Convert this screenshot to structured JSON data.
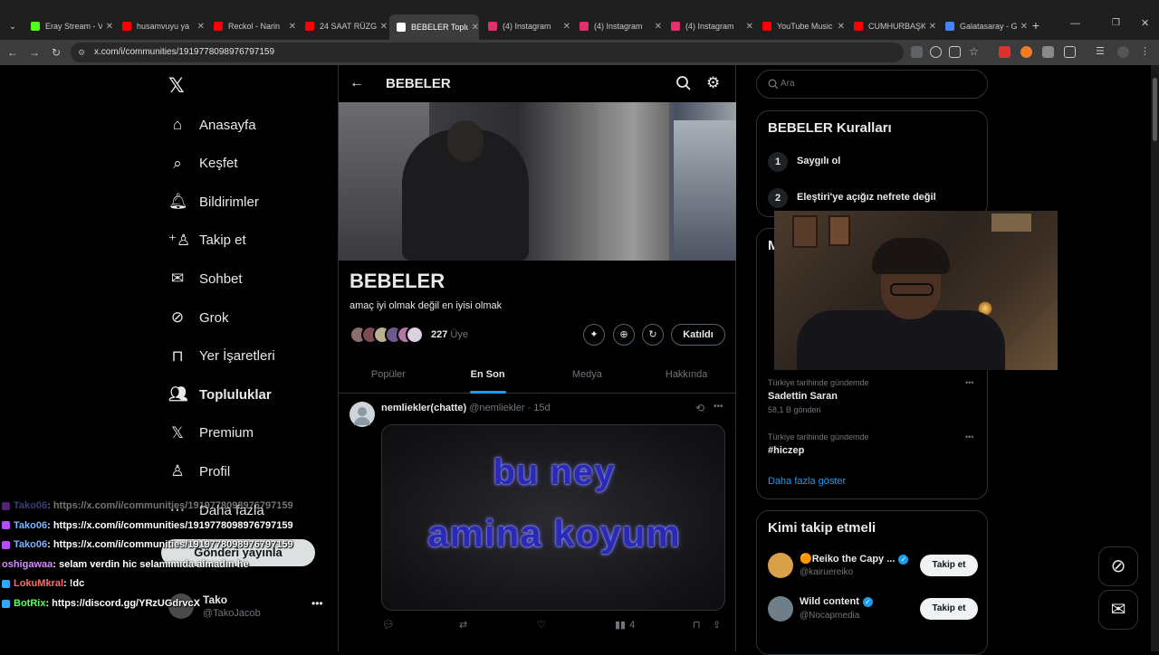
{
  "browser": {
    "tabs": [
      {
        "label": "Eray Stream - V",
        "color": "#53fc18"
      },
      {
        "label": "husamvuyu ya",
        "color": "#ff0000"
      },
      {
        "label": "Reckol - Narin",
        "color": "#ff0000"
      },
      {
        "label": "24 SAAT RÜZG",
        "color": "#ff0000"
      },
      {
        "label": "BEBELER Toplu",
        "color": "#ffffff"
      },
      {
        "label": "(4) Instagram",
        "color": "#e1306c"
      },
      {
        "label": "(4) Instagram",
        "color": "#e1306c"
      },
      {
        "label": "(4) Instagram",
        "color": "#e1306c"
      },
      {
        "label": "YouTube Music",
        "color": "#ff0000"
      },
      {
        "label": "CUMHURBAŞK",
        "color": "#ff0000"
      },
      {
        "label": "Galatasaray - G",
        "color": "#4285f4"
      }
    ],
    "url": "x.com/i/communities/1919778098976797159"
  },
  "nav": {
    "items": [
      {
        "label": "Anasayfa",
        "icon": "home-icon"
      },
      {
        "label": "Keşfet",
        "icon": "search-icon"
      },
      {
        "label": "Bildirimler",
        "icon": "bell-icon"
      },
      {
        "label": "Takip et",
        "icon": "add-user-icon"
      },
      {
        "label": "Sohbet",
        "icon": "mail-icon"
      },
      {
        "label": "Grok",
        "icon": "grok-icon"
      },
      {
        "label": "Yer İşaretleri",
        "icon": "bookmark-icon"
      },
      {
        "label": "Topluluklar",
        "icon": "communities-icon"
      },
      {
        "label": "Premium",
        "icon": "x-logo-icon"
      },
      {
        "label": "Profil",
        "icon": "profile-icon"
      },
      {
        "label": "Daha fazla",
        "icon": "more-icon"
      }
    ],
    "post_button": "Gönderi yayınla",
    "account_name": "Tako",
    "account_handle": "@TakoJacob"
  },
  "community": {
    "header_title": "BEBELER",
    "name": "BEBELER",
    "description": "amaç iyi olmak değil en iyisi olmak",
    "member_count": "227",
    "member_label": "Üye",
    "joined_button": "Katıldı",
    "tabs": [
      "Popüler",
      "En Son",
      "Medya",
      "Hakkında"
    ],
    "active_tab": 1
  },
  "post": {
    "author": "nemliekler(chatte)",
    "handle": "@nemliekler",
    "time": "· 15d",
    "image_text_line1": "bu ney",
    "image_text_line2": "amina koyum",
    "views": "4"
  },
  "sidebar": {
    "search_placeholder": "Ara",
    "rules_title": "BEBELER Kuralları",
    "rules": [
      "Saygılı ol",
      "Eleştiri'ye açığız nefrete değil"
    ],
    "trends": [
      {
        "context": "Türkiye tarihinde gündemde",
        "name": "Sadettin Saran",
        "count": "58,1 B gönderi"
      },
      {
        "context": "Türkiye tarihinde gündemde",
        "name": "#hiczep",
        "count": ""
      }
    ],
    "show_more": "Daha fazla göster",
    "who_to_follow_title": "Kimi takip etmeli",
    "suggestions": [
      {
        "name": "🟠Reiko the Capy ...",
        "handle": "@kairuereiko",
        "button": "Takip et"
      },
      {
        "name": "Wild content",
        "handle": "@Nocapmedia",
        "button": "Takip et"
      }
    ]
  },
  "chat": [
    {
      "user": "Tako06",
      "message": " : https://x.com/i/communities/1919778098976797159",
      "color": "#8a8cff",
      "icon": "#b54cff"
    },
    {
      "user": "Tako06",
      "message": " : https://x.com/i/communities/1919778098976797159",
      "color": "#7fb2ff",
      "icon": "#b54cff"
    },
    {
      "user": "Tako06",
      "message": " : https://x.com/i/communities/1919778098976797159",
      "color": "#7fb2ff",
      "icon": "#b54cff"
    },
    {
      "user": "oshigawaa",
      "message": " : selam verdin hic selamımıda almadın he",
      "color": "#d38cff",
      "icon": ""
    },
    {
      "user": "LokuMkral",
      "message": " : !dc",
      "color": "#ff6b6b",
      "icon": "#2fa8ff"
    },
    {
      "user": "BotRix",
      "message": " : https://discord.gg/YRzUGdrvcX",
      "color": "#5cff5c",
      "icon": "#2fa8ff"
    }
  ]
}
